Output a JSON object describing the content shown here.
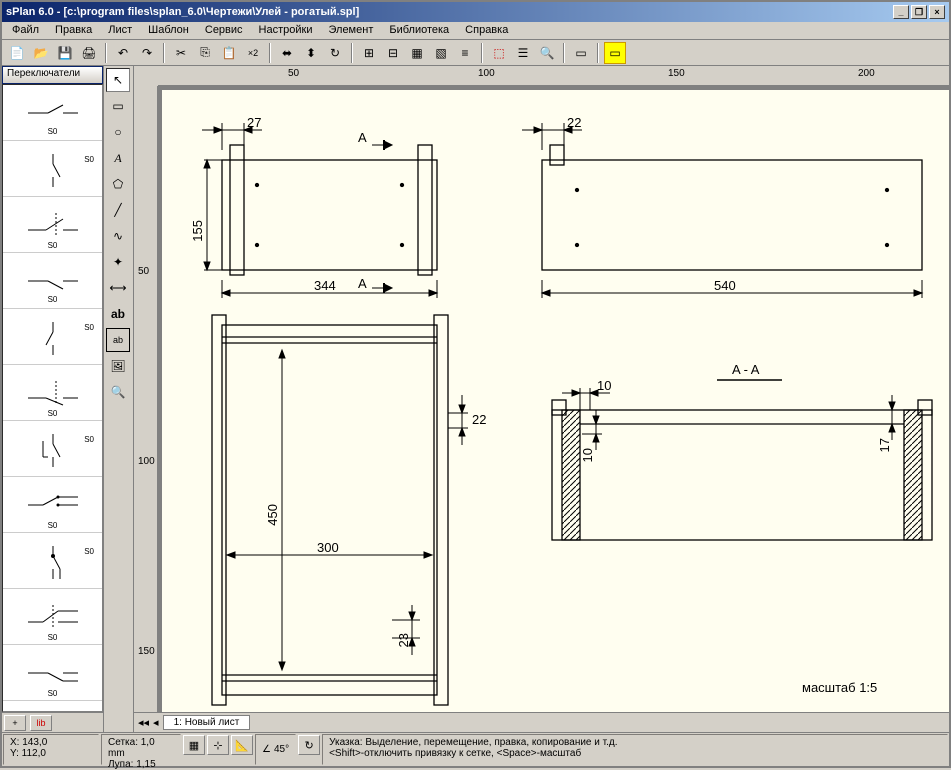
{
  "title": "sPlan 6.0 - [c:\\program files\\splan_6.0\\Чертежи\\Улей - рогатый.spl]",
  "menu": [
    "Файл",
    "Правка",
    "Лист",
    "Шаблон",
    "Сервис",
    "Настройки",
    "Элемент",
    "Библиотека",
    "Справка"
  ],
  "palette": {
    "dropdown": "Переключатели"
  },
  "ruler": {
    "h": [
      "50",
      "100",
      "150",
      "200"
    ],
    "v": [
      "50",
      "100",
      "150"
    ]
  },
  "drawing": {
    "dims": {
      "d27": "27",
      "dA1": "A",
      "d22a": "22",
      "d155": "155",
      "d344": "344",
      "dA2": "A",
      "d540": "540",
      "d22b": "22",
      "dAA": "A - A",
      "d10a": "10",
      "d10b": "10",
      "d17": "17",
      "d450": "450",
      "d300": "300",
      "d23": "23",
      "scale": "масштаб  1:5"
    }
  },
  "tab": "1: Новый лист",
  "status": {
    "x": "X: 143,0",
    "y": "Y: 112,0",
    "grid": "Сетка: 1,0 mm",
    "zoom": "Лупа: 1,15",
    "angle": "45°",
    "hint1": "Указка: Выделение, перемещение, правка, копирование и т.д.",
    "hint2": "<Shift>-отключить привязку к сетке, <Space>-масштаб"
  }
}
